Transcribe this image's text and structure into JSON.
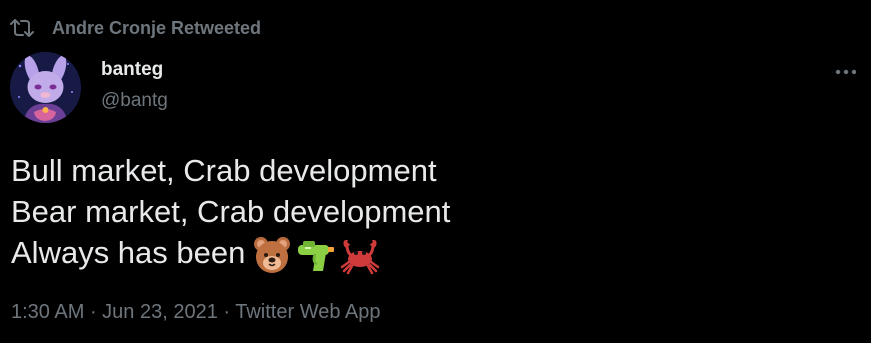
{
  "retweet": {
    "label": "Andre Cronje Retweeted"
  },
  "author": {
    "name": "banteg",
    "handle": "@bantg"
  },
  "tweet": {
    "line1": "Bull market, Crab development",
    "line2": "Bear market, Crab development",
    "line3": "Always has been",
    "emojis": [
      "bear-face",
      "water-pistol",
      "crab"
    ]
  },
  "meta": {
    "time": "1:30 AM",
    "separator1": " · ",
    "date": "Jun 23, 2021",
    "separator2": " · ",
    "source": "Twitter Web App"
  },
  "colors": {
    "background": "#000000",
    "primary_text": "#e7e9ea",
    "secondary_text": "#6e767d"
  }
}
